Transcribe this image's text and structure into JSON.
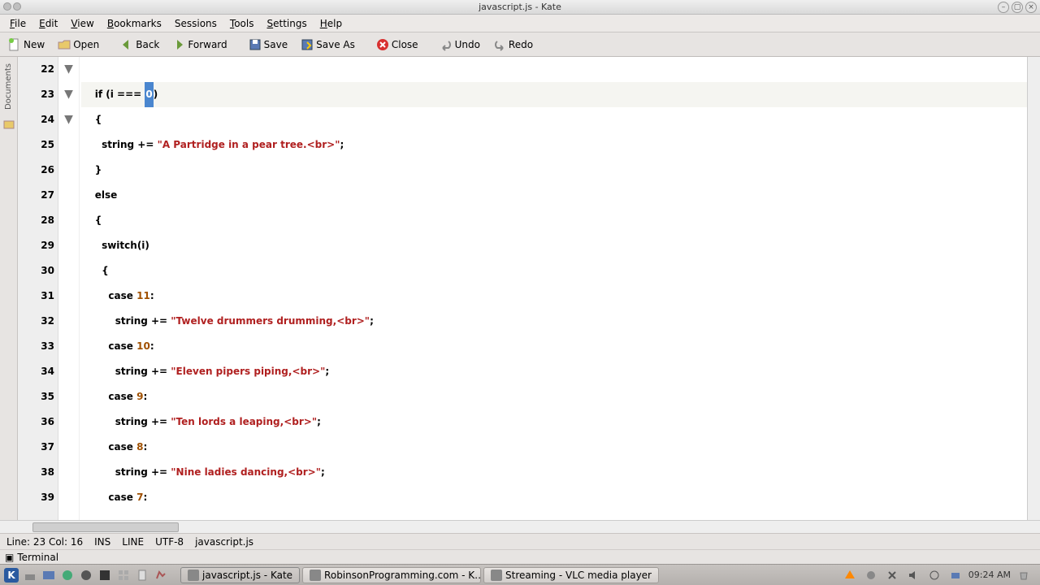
{
  "window": {
    "title": "javascript.js - Kate"
  },
  "menu": {
    "file": "File",
    "edit": "Edit",
    "view": "View",
    "bookmarks": "Bookmarks",
    "sessions": "Sessions",
    "tools": "Tools",
    "settings": "Settings",
    "help": "Help"
  },
  "toolbar": {
    "new": "New",
    "open": "Open",
    "back": "Back",
    "forward": "Forward",
    "save": "Save",
    "saveas": "Save As",
    "close": "Close",
    "undo": "Undo",
    "redo": "Redo"
  },
  "sidebar": {
    "documents": "Documents"
  },
  "code": {
    "lines": [
      {
        "n": 22,
        "indent": "",
        "tokens": []
      },
      {
        "n": 23,
        "indent": "    ",
        "current": true,
        "tokens": [
          {
            "t": "kw",
            "v": "if"
          },
          {
            "t": "p",
            "v": " (i === "
          },
          {
            "t": "sel",
            "v": "0"
          },
          {
            "t": "p",
            "v": ")"
          }
        ]
      },
      {
        "n": 24,
        "indent": "    ",
        "fold": true,
        "tokens": [
          {
            "t": "p",
            "v": "{"
          }
        ]
      },
      {
        "n": 25,
        "indent": "      ",
        "tokens": [
          {
            "t": "p",
            "v": "string += "
          },
          {
            "t": "str",
            "v": "\"A Partridge in a pear tree.<br>\""
          },
          {
            "t": "p",
            "v": ";"
          }
        ]
      },
      {
        "n": 26,
        "indent": "    ",
        "tokens": [
          {
            "t": "p",
            "v": "}"
          }
        ]
      },
      {
        "n": 27,
        "indent": "    ",
        "tokens": [
          {
            "t": "kw",
            "v": "else"
          }
        ]
      },
      {
        "n": 28,
        "indent": "    ",
        "fold": true,
        "tokens": [
          {
            "t": "p",
            "v": "{"
          }
        ]
      },
      {
        "n": 29,
        "indent": "      ",
        "tokens": [
          {
            "t": "kw",
            "v": "switch"
          },
          {
            "t": "p",
            "v": "(i)"
          }
        ]
      },
      {
        "n": 30,
        "indent": "      ",
        "fold": true,
        "tokens": [
          {
            "t": "p",
            "v": "{"
          }
        ]
      },
      {
        "n": 31,
        "indent": "        ",
        "tokens": [
          {
            "t": "kw",
            "v": "case"
          },
          {
            "t": "p",
            "v": " "
          },
          {
            "t": "num",
            "v": "11"
          },
          {
            "t": "p",
            "v": ":"
          }
        ]
      },
      {
        "n": 32,
        "indent": "          ",
        "tokens": [
          {
            "t": "p",
            "v": "string += "
          },
          {
            "t": "str",
            "v": "\"Twelve drummers drumming,<br>\""
          },
          {
            "t": "p",
            "v": ";"
          }
        ]
      },
      {
        "n": 33,
        "indent": "        ",
        "tokens": [
          {
            "t": "kw",
            "v": "case"
          },
          {
            "t": "p",
            "v": " "
          },
          {
            "t": "num",
            "v": "10"
          },
          {
            "t": "p",
            "v": ":"
          }
        ]
      },
      {
        "n": 34,
        "indent": "          ",
        "tokens": [
          {
            "t": "p",
            "v": "string += "
          },
          {
            "t": "str",
            "v": "\"Eleven pipers piping,<br>\""
          },
          {
            "t": "p",
            "v": ";"
          }
        ]
      },
      {
        "n": 35,
        "indent": "        ",
        "tokens": [
          {
            "t": "kw",
            "v": "case"
          },
          {
            "t": "p",
            "v": " "
          },
          {
            "t": "num",
            "v": "9"
          },
          {
            "t": "p",
            "v": ":"
          }
        ]
      },
      {
        "n": 36,
        "indent": "          ",
        "tokens": [
          {
            "t": "p",
            "v": "string += "
          },
          {
            "t": "str",
            "v": "\"Ten lords a leaping,<br>\""
          },
          {
            "t": "p",
            "v": ";"
          }
        ]
      },
      {
        "n": 37,
        "indent": "        ",
        "tokens": [
          {
            "t": "kw",
            "v": "case"
          },
          {
            "t": "p",
            "v": " "
          },
          {
            "t": "num",
            "v": "8"
          },
          {
            "t": "p",
            "v": ":"
          }
        ]
      },
      {
        "n": 38,
        "indent": "          ",
        "tokens": [
          {
            "t": "p",
            "v": "string += "
          },
          {
            "t": "str",
            "v": "\"Nine ladies dancing,<br>\""
          },
          {
            "t": "p",
            "v": ";"
          }
        ]
      },
      {
        "n": 39,
        "indent": "        ",
        "tokens": [
          {
            "t": "kw",
            "v": "case"
          },
          {
            "t": "p",
            "v": " "
          },
          {
            "t": "num",
            "v": "7"
          },
          {
            "t": "p",
            "v": ":"
          }
        ]
      }
    ]
  },
  "status": {
    "pos": "Line: 23 Col: 16",
    "mode": "INS",
    "linemode": "LINE",
    "enc": "UTF-8",
    "file": "javascript.js"
  },
  "bottom": {
    "terminal": "Terminal"
  },
  "taskbar": {
    "tasks": [
      {
        "label": "javascript.js - Kate",
        "active": true
      },
      {
        "label": "RobinsonProgramming.com - K…"
      },
      {
        "label": "Streaming - VLC media player"
      }
    ],
    "clock": "09:24 AM"
  }
}
